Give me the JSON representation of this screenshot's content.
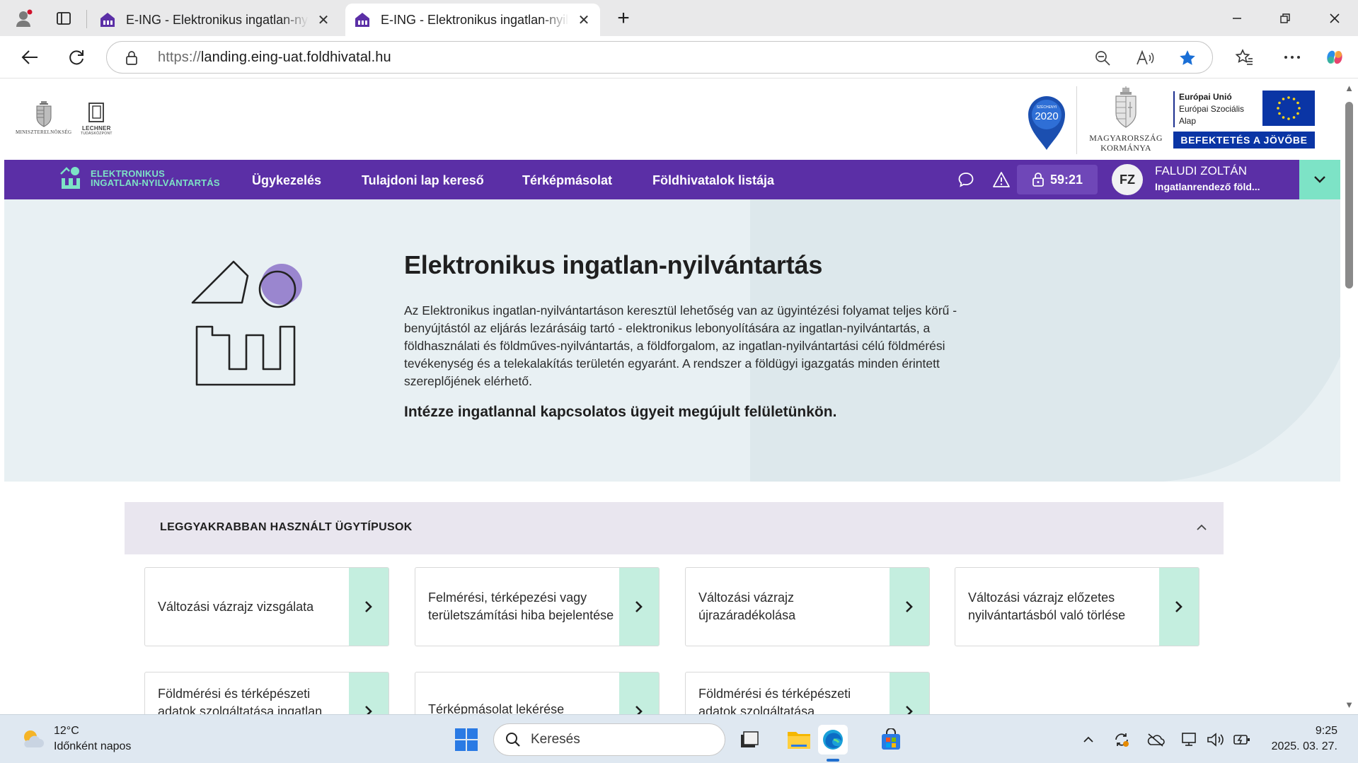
{
  "browser": {
    "tabs": [
      {
        "title": "E-ING - Elektronikus ingatlan-nyilvántartás",
        "active": false
      },
      {
        "title": "E-ING - Elektronikus ingatlan-nyilvántartás",
        "active": true
      }
    ],
    "new_tab_symbol": "+",
    "close_symbol": "✕",
    "url_protocol": "https://",
    "url_host": "landing.eing-uat.foldhivatal.hu"
  },
  "site": {
    "header": {
      "logo_left_1": "MINISZTERELNÖKSÉG",
      "logo_left_2": "LECHNER",
      "logo_left_2_sub": "TUDÁSKÖZPONT",
      "gov_caption_1": "MAGYARORSZÁG",
      "gov_caption_2": "KORMÁNYA",
      "szechenyi_label": "SZÉCHENYI",
      "szechenyi_year": "2020",
      "eu_line_1": "Európai Unió",
      "eu_line_2": "Európai Szociális",
      "eu_line_3": "Alap",
      "eu_banner": "BEFEKTETÉS A JÖVŐBE"
    },
    "nav": {
      "brand_line_1": "ELEKTRONIKUS",
      "brand_line_2": "INGATLAN-NYILVÁNTARTÁS",
      "links": [
        "Ügykezelés",
        "Tulajdoni lap kereső",
        "Térképmásolat",
        "Földhivatalok listája"
      ],
      "timer": "59:21",
      "user_initials": "FZ",
      "user_name": "FALUDI ZOLTÁN",
      "user_role": "Ingatlanrendező föld..."
    },
    "hero": {
      "title": "Elektronikus ingatlan-nyilvántartás",
      "text": "Az Elektronikus ingatlan-nyilvántartáson keresztül lehetőség van az ügyintézési folyamat teljes körű - benyújtástól az eljárás lezárásáig tartó - elektronikus lebonyolítására az ingatlan-nyilvántartás, a földhasználati és földműves-nyilvántartás, a földforgalom, az ingatlan-nyilvántartási célú földmérési tevékenység és a telekalakítás területén egyaránt. A rendszer a földügyi igazgatás minden érintett szereplőjének elérhető.",
      "subtitle": "Intézze ingatlannal kapcsolatos ügyeit megújult felületünkön."
    },
    "panel": {
      "title": "LEGGYAKRABBAN HASZNÁLT ÜGYTÍPUSOK",
      "cards": [
        "Változási vázrajz vizsgálata",
        "Felmérési, térképezési vagy területszámítási hiba bejelentése",
        "Változási vázrajz újrazáradékolása",
        "Változási vázrajz előzetes nyilvántartásból való törlése",
        "Földmérési és térképészeti adatok szolgáltatása ingatlan",
        "Térképmásolat lekérése",
        "Földmérési és térképészeti adatok szolgáltatása"
      ]
    }
  },
  "taskbar": {
    "temperature": "12°C",
    "weather": "Időnként napos",
    "search_placeholder": "Keresés",
    "time": "9:25",
    "date": "2025. 03. 27."
  },
  "colors": {
    "brand_purple": "#5b2fa6",
    "brand_mint": "#7de3c6",
    "card_button": "#c4eedf",
    "hero_bg": "#e8f0f3"
  }
}
